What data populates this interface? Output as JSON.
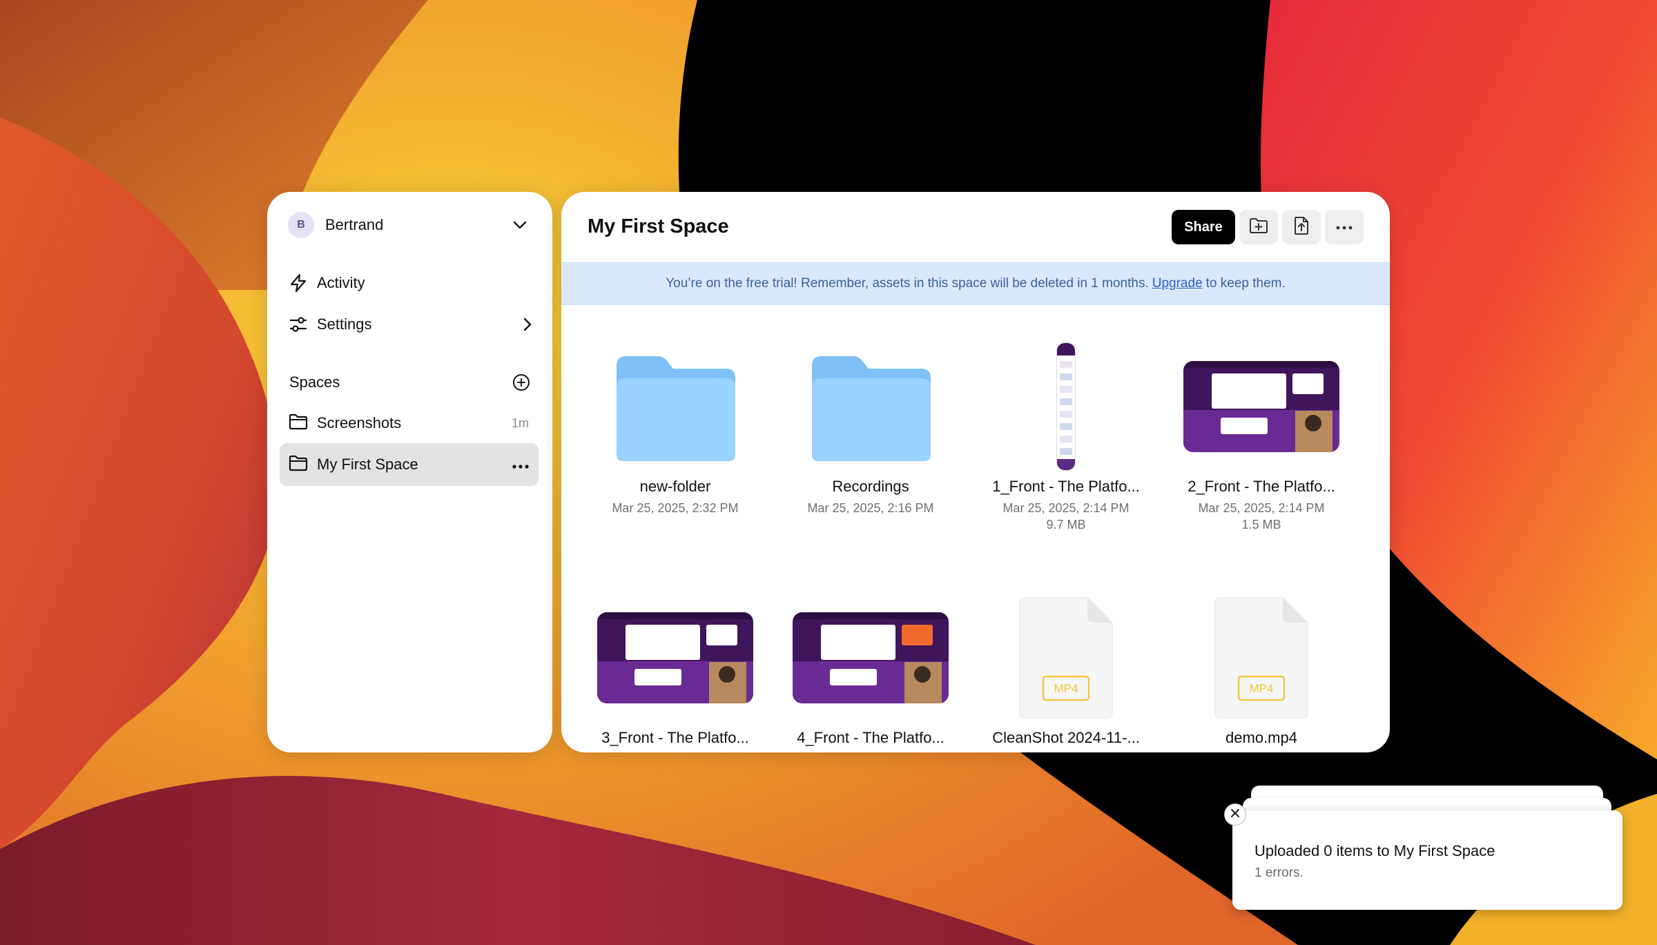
{
  "sidebar": {
    "user": {
      "initial": "B",
      "name": "Bertrand"
    },
    "nav": [
      {
        "label": "Activity",
        "icon": "bolt-icon"
      },
      {
        "label": "Settings",
        "icon": "sliders-icon"
      }
    ],
    "spaces_header": "Spaces",
    "spaces": [
      {
        "label": "Screenshots",
        "meta": "1m",
        "active": false
      },
      {
        "label": "My First Space",
        "meta": "",
        "active": true
      }
    ]
  },
  "main": {
    "title": "My First Space",
    "share_label": "Share",
    "banner": {
      "text_before": "You’re on the free trial! Remember, assets in this space will be deleted in 1 months.",
      "link": "Upgrade",
      "text_after": "to keep them."
    },
    "items": [
      {
        "name": "new-folder",
        "date": "Mar 25, 2025, 2:32 PM",
        "size": "",
        "kind": "folder"
      },
      {
        "name": "Recordings",
        "date": "Mar 25, 2025, 2:16 PM",
        "size": "",
        "kind": "folder"
      },
      {
        "name": "1_Front - The Platfo...",
        "date": "Mar 25, 2025, 2:14 PM",
        "size": "9.7 MB",
        "kind": "tall-screenshot"
      },
      {
        "name": "2_Front - The Platfo...",
        "date": "Mar 25, 2025, 2:14 PM",
        "size": "1.5 MB",
        "kind": "screenshot"
      },
      {
        "name": "3_Front - The Platfo...",
        "date": "",
        "size": "",
        "kind": "screenshot"
      },
      {
        "name": "4_Front - The Platfo...",
        "date": "",
        "size": "",
        "kind": "screenshot"
      },
      {
        "name": "CleanShot 2024-11-...",
        "date": "",
        "size": "",
        "kind": "file",
        "badge": "MP4"
      },
      {
        "name": "demo.mp4",
        "date": "",
        "size": "",
        "kind": "file",
        "badge": "MP4"
      }
    ]
  },
  "toast": {
    "title": "Uploaded 0 items to My First Space",
    "subtitle": "1 errors."
  },
  "colors": {
    "folder_back": "#7ec0f7",
    "folder_front": "#9ad3ff",
    "mp4_badge": "#f2c531",
    "banner_bg": "#dbe8fb"
  }
}
